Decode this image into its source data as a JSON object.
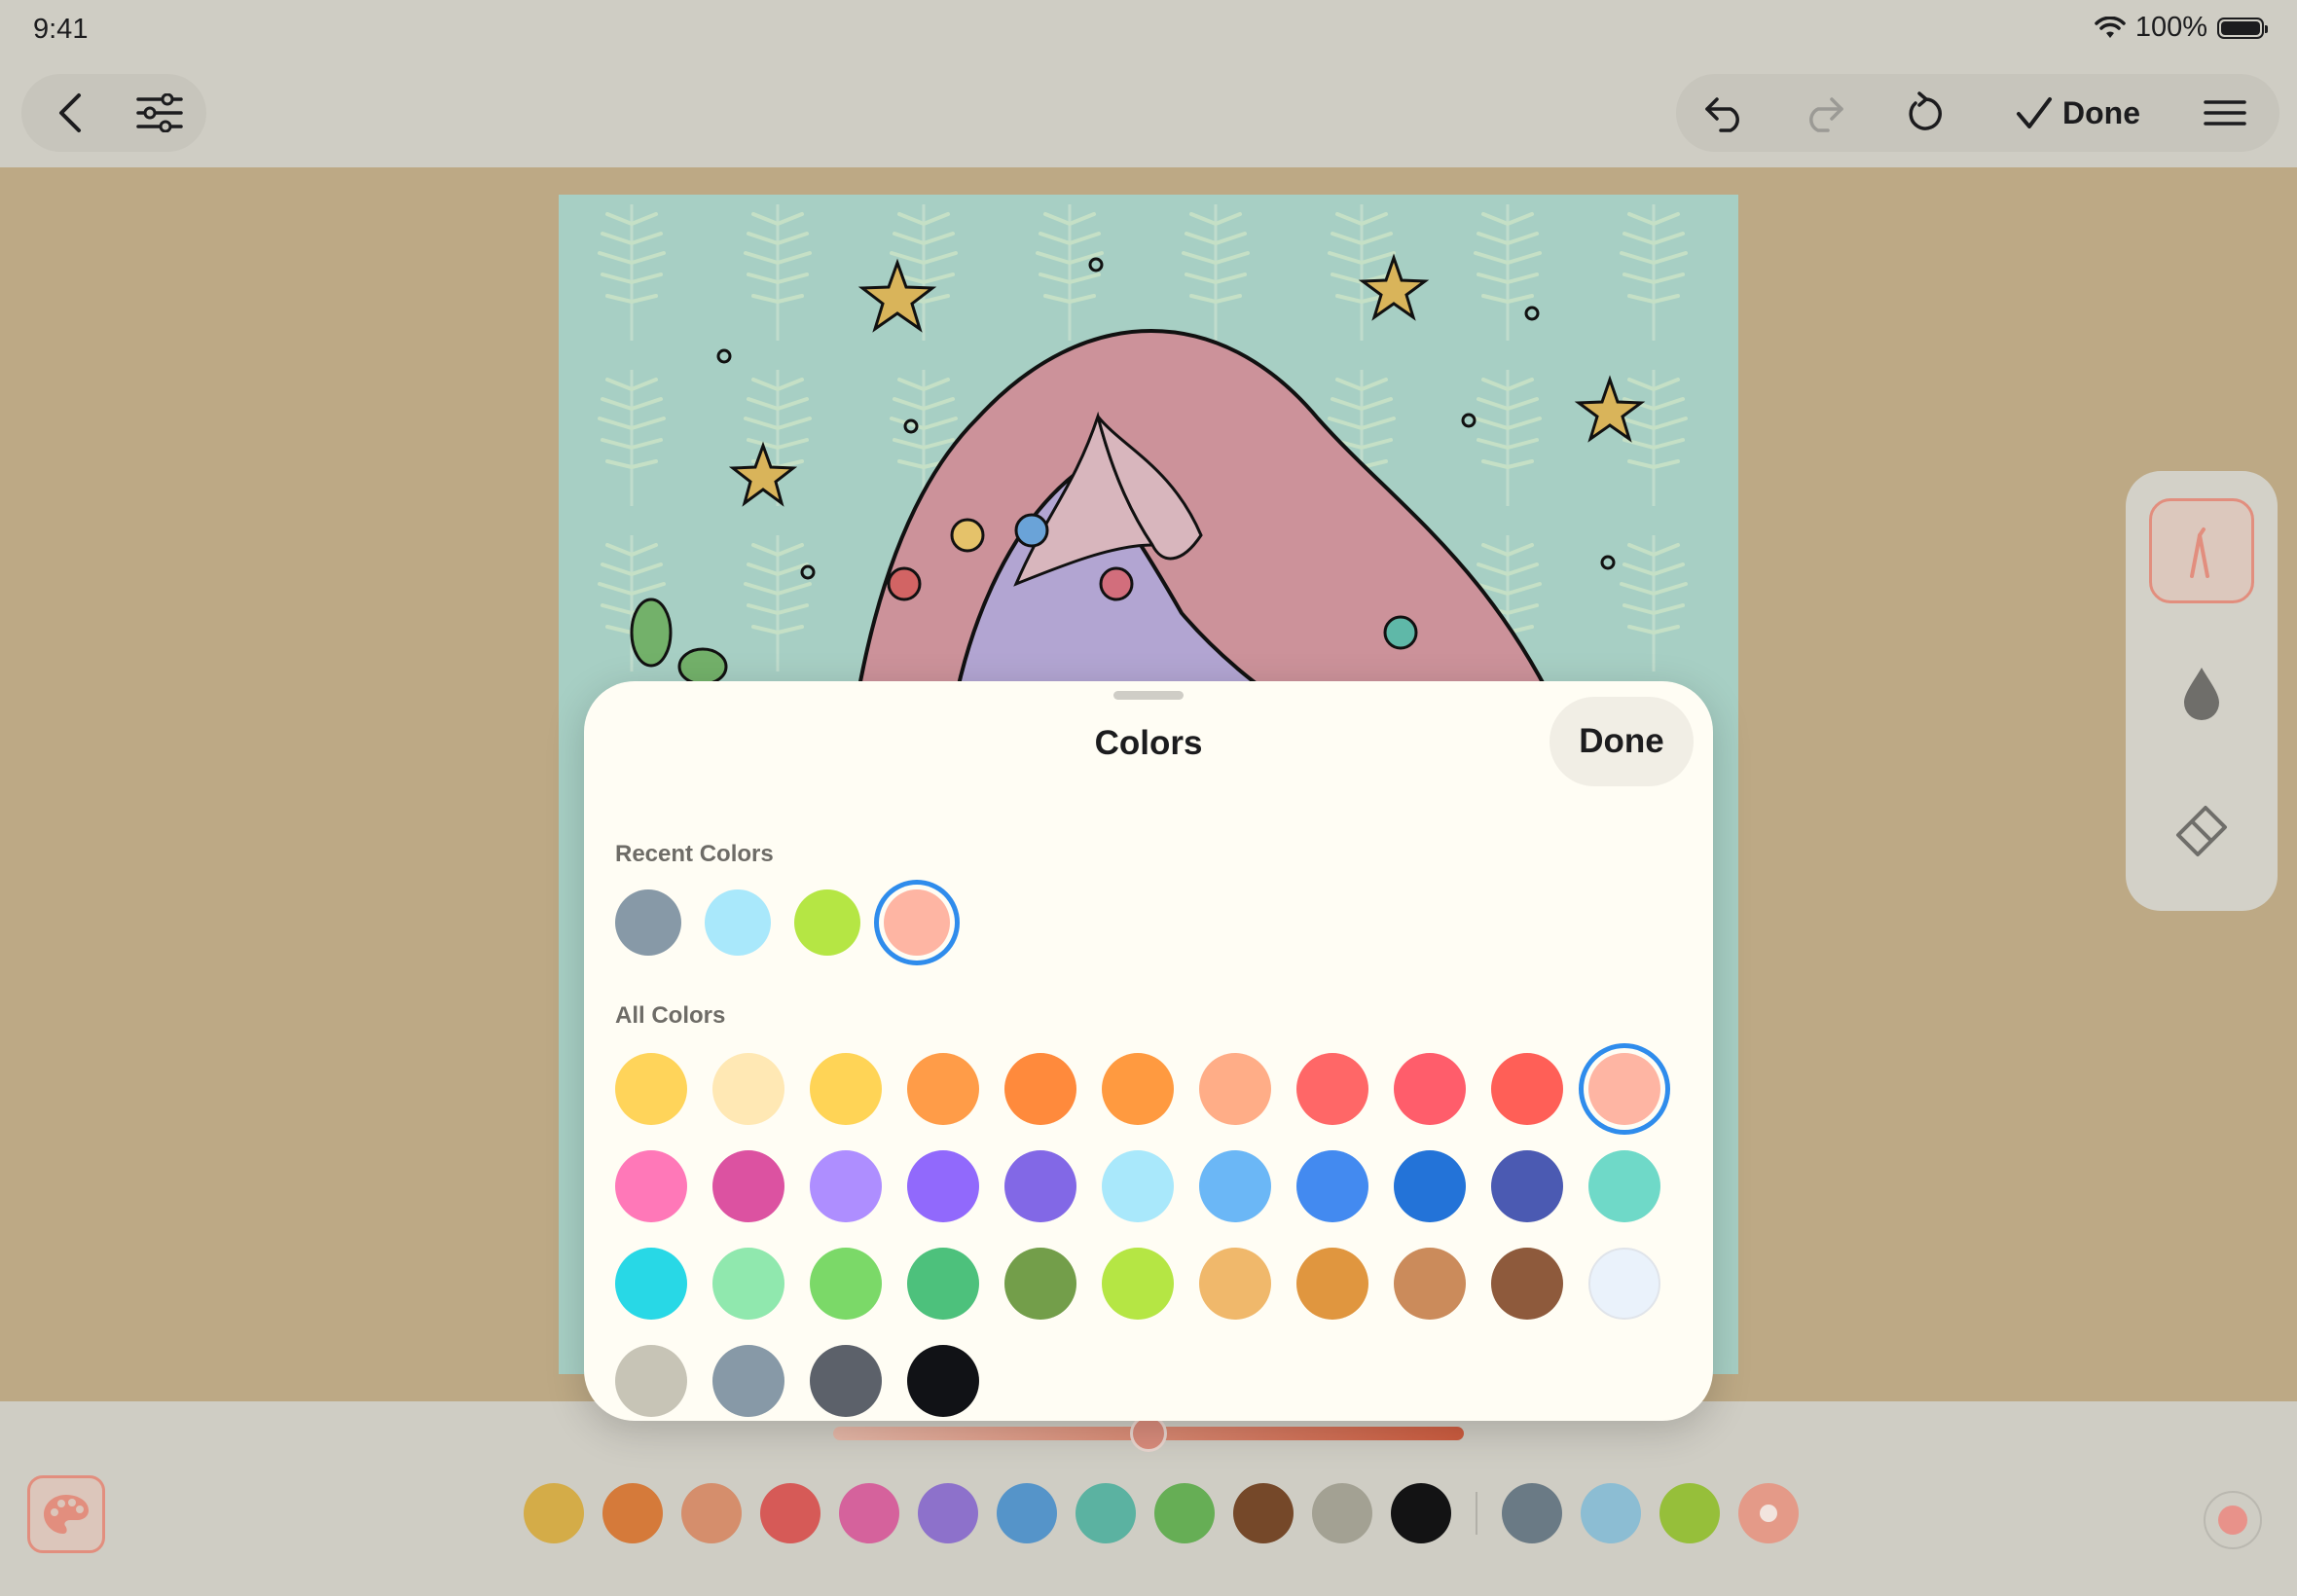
{
  "status_bar": {
    "time": "9:41",
    "battery": "100%"
  },
  "toolbar": {
    "done_label": "Done"
  },
  "colors_sheet": {
    "title": "Colors",
    "done_label": "Done",
    "recent_label": "Recent Colors",
    "all_label": "All Colors",
    "recent_colors": [
      "#8799a7",
      "#a9e8fb",
      "#b5e644",
      "#feb5a3"
    ],
    "recent_selected_index": 3,
    "all_colors": [
      [
        "#ffd45a",
        "#ffe8b4",
        "#ffd456",
        "#ff9c48",
        "#ff8a3c",
        "#ff9a40",
        "#ffad87",
        "#ff6767",
        "#ff5d6b",
        "#ff5f57",
        "#feb5a3"
      ],
      [
        "#ff78b8",
        "#dc52a1",
        "#ae8eff",
        "#9169fc",
        "#8268e6",
        "#a9e8fb",
        "#6bb7f6",
        "#438af0",
        "#2373d8",
        "#4b5ab2",
        "#6fd9c8"
      ],
      [
        "#28d8e6",
        "#90e8ae",
        "#7bd968",
        "#4dc17c",
        "#739e4a",
        "#b5e644",
        "#f0b86b",
        "#e0963f",
        "#cb8b5b",
        "#8e5a3c",
        "#eaf2fb"
      ],
      [
        "#c7c4b6",
        "#8799a7",
        "#5c616a",
        "#111216"
      ]
    ],
    "all_selected": [
      0,
      10
    ]
  },
  "brush": {
    "opacity_percent": 50
  },
  "bottom_palette": {
    "colors": [
      "#d4ac48",
      "#d57a3a",
      "#d58e6c",
      "#d65a57",
      "#d5629c",
      "#8d71cb",
      "#5594c9",
      "#5bb2a1",
      "#66ae55",
      "#754829",
      "#a3a193",
      "#131314"
    ],
    "recent_colors": [
      "#6a7a85",
      "#8cbdd3",
      "#96bf3a",
      "#e49a88"
    ]
  }
}
